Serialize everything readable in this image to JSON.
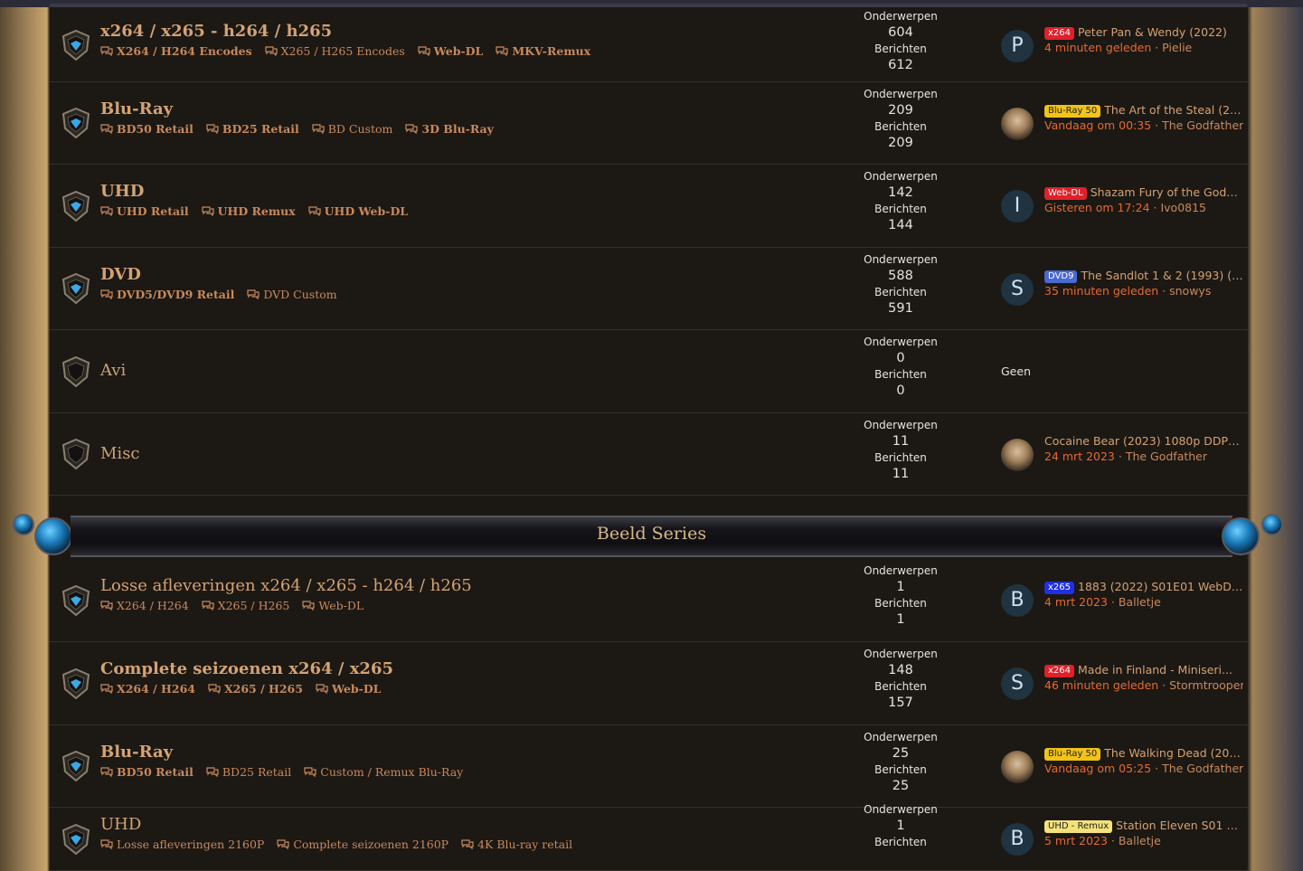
{
  "labels": {
    "topics": "Onderwerpen",
    "posts": "Berichten"
  },
  "section1_rows": [
    {
      "title": "x264 / x265 - h264 / h265",
      "bold": true,
      "subs": [
        {
          "label": "X264 / H264 Encodes",
          "bold": true
        },
        {
          "label": "X265 / H265 Encodes",
          "bold": false
        },
        {
          "label": "Web-DL",
          "bold": true
        },
        {
          "label": "MKV-Remux",
          "bold": true
        }
      ],
      "topics": "604",
      "posts": "612",
      "avatar": "P",
      "photo": false,
      "badge": "x264",
      "badge_bg": "#e0202a",
      "badge_fg": "#ffffff",
      "last_title": "Peter Pan & Wendy (2022)",
      "last_time": "4 minuten geleden",
      "last_user": "Pielie"
    },
    {
      "title": "Blu-Ray",
      "bold": true,
      "subs": [
        {
          "label": "BD50 Retail",
          "bold": true
        },
        {
          "label": "BD25 Retail",
          "bold": true
        },
        {
          "label": "BD Custom",
          "bold": false
        },
        {
          "label": "3D Blu-Ray",
          "bold": true
        }
      ],
      "topics": "209",
      "posts": "209",
      "avatar": "",
      "photo": true,
      "badge": "Blu-Ray 50",
      "badge_bg": "#f2c318",
      "badge_fg": "#202020",
      "last_title": "The Art of the Steal (20...",
      "last_time": "Vandaag om 00:35",
      "last_user": "The Godfather"
    },
    {
      "title": "UHD",
      "bold": true,
      "subs": [
        {
          "label": "UHD Retail",
          "bold": true
        },
        {
          "label": "UHD Remux",
          "bold": true
        },
        {
          "label": "UHD Web-DL",
          "bold": true
        }
      ],
      "topics": "142",
      "posts": "144",
      "avatar": "I",
      "photo": false,
      "badge": "Web-DL",
      "badge_bg": "#e0202a",
      "badge_fg": "#ffffff",
      "last_title": "Shazam Fury of the Gods ...",
      "last_time": "Gisteren om 17:24",
      "last_user": "Ivo0815"
    },
    {
      "title": "DVD",
      "bold": true,
      "subs": [
        {
          "label": "DVD5/DVD9 Retail",
          "bold": true
        },
        {
          "label": "DVD Custom",
          "bold": false
        }
      ],
      "topics": "588",
      "posts": "591",
      "avatar": "S",
      "photo": false,
      "badge": "DVD9",
      "badge_bg": "#4a6ad0",
      "badge_fg": "#ffffff",
      "last_title": "The Sandlot 1 & 2 (1993) (20...",
      "last_time": "35 minuten geleden",
      "last_user": "snowys"
    },
    {
      "title": "Avi",
      "bold": false,
      "subs": [],
      "topics": "0",
      "posts": "0",
      "geen": "Geen"
    },
    {
      "title": "Misc",
      "bold": false,
      "subs": [],
      "topics": "11",
      "posts": "11",
      "avatar": "",
      "photo": true,
      "badge": "",
      "last_title": "Cocaine Bear (2023) 1080p DDP5.1...",
      "last_time": "24 mrt 2023",
      "last_user": "The Godfather"
    }
  ],
  "section2_title": "Beeld Series",
  "section2_rows": [
    {
      "title": "Losse afleveringen x264 / x265 - h264 / h265",
      "bold": false,
      "subs": [
        {
          "label": "X264 / H264",
          "bold": false
        },
        {
          "label": "X265 / H265",
          "bold": false
        },
        {
          "label": "Web-DL",
          "bold": false
        }
      ],
      "topics": "1",
      "posts": "1",
      "avatar": "B",
      "photo": false,
      "badge": "x265",
      "badge_bg": "#2030e0",
      "badge_fg": "#ffffff",
      "last_title": "1883 (2022) S01E01 WebDl 2...",
      "last_time": "4 mrt 2023",
      "last_user": "Balletje"
    },
    {
      "title": "Complete seizoenen x264 / x265",
      "bold": true,
      "subs": [
        {
          "label": "X264 / H264",
          "bold": true
        },
        {
          "label": "X265 / H265",
          "bold": true
        },
        {
          "label": "Web-DL",
          "bold": true
        }
      ],
      "topics": "148",
      "posts": "157",
      "avatar": "S",
      "photo": false,
      "badge": "x264",
      "badge_bg": "#e0202a",
      "badge_fg": "#ffffff",
      "last_title": "Made in Finland - Miniseri...",
      "last_time": "46 minuten geleden",
      "last_user": "Stormtrooper"
    },
    {
      "title": "Blu-Ray",
      "bold": true,
      "subs": [
        {
          "label": "BD50 Retail",
          "bold": true
        },
        {
          "label": "BD25 Retail",
          "bold": false
        },
        {
          "label": "Custom / Remux Blu-Ray",
          "bold": false
        }
      ],
      "topics": "25",
      "posts": "25",
      "avatar": "",
      "photo": true,
      "badge": "Blu-Ray 50",
      "badge_bg": "#f2c318",
      "badge_fg": "#202020",
      "last_title": "The Walking Dead (201...",
      "last_time": "Vandaag om 05:25",
      "last_user": "The Godfather"
    },
    {
      "title": "UHD",
      "bold": false,
      "subs": [
        {
          "label": "Losse afleveringen 2160P",
          "bold": false
        },
        {
          "label": "Complete seizoenen 2160P",
          "bold": false
        },
        {
          "label": "4K Blu-ray retail",
          "bold": false
        }
      ],
      "topics": "1",
      "posts": "",
      "avatar": "B",
      "photo": false,
      "badge": "UHD - Remux",
      "badge_bg": "#f4e27a",
      "badge_fg": "#202020",
      "last_title": "Station Eleven S01 Bl...",
      "last_time": "5 mrt 2023",
      "last_user": "Balletje"
    }
  ]
}
